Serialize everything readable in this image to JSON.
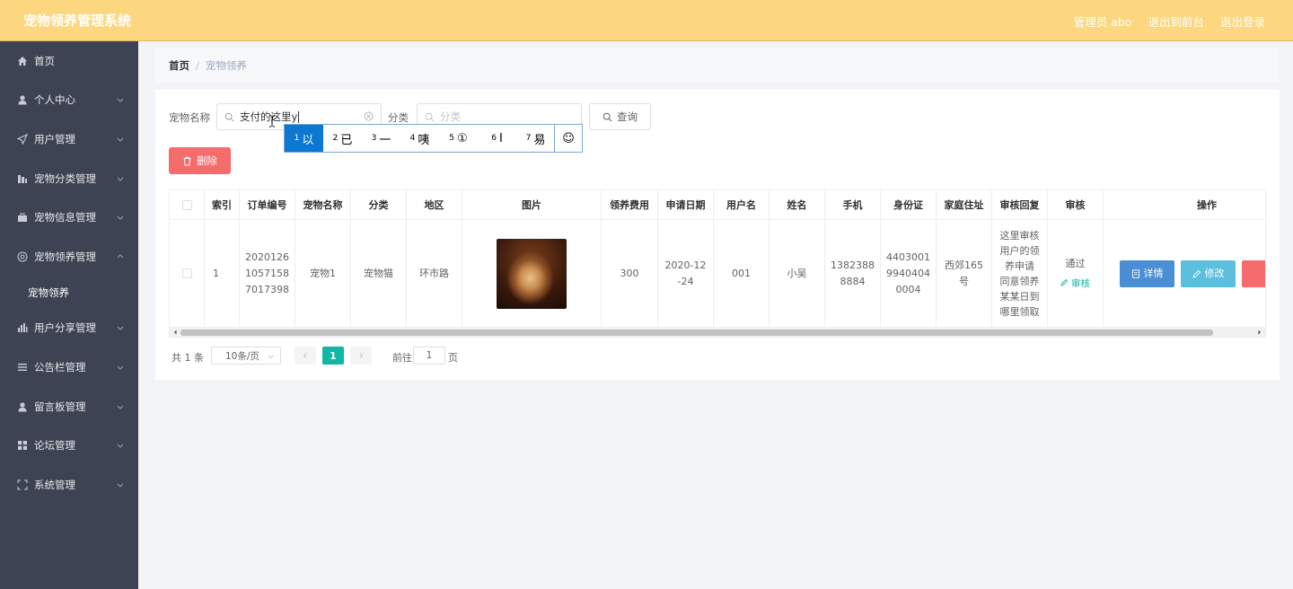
{
  "app": {
    "title": "宠物领养管理系统"
  },
  "topbar": {
    "admin_label": "管理员 abo",
    "front_link": "退出到前台",
    "logout": "退出登录"
  },
  "sidebar": {
    "items": [
      {
        "label": "首页",
        "icon": "home-icon",
        "expandable": false
      },
      {
        "label": "个人中心",
        "icon": "user-icon",
        "expandable": true
      },
      {
        "label": "用户管理",
        "icon": "send-icon",
        "expandable": true
      },
      {
        "label": "宠物分类管理",
        "icon": "chart-icon",
        "expandable": true
      },
      {
        "label": "宠物信息管理",
        "icon": "suitcase-icon",
        "expandable": true
      },
      {
        "label": "宠物领养管理",
        "icon": "globe-icon",
        "expandable": true,
        "open": true
      },
      {
        "label": "用户分享管理",
        "icon": "bar-chart-icon",
        "expandable": true
      },
      {
        "label": "公告栏管理",
        "icon": "list-icon",
        "expandable": true
      },
      {
        "label": "留言板管理",
        "icon": "user-icon",
        "expandable": true
      },
      {
        "label": "论坛管理",
        "icon": "grid-icon",
        "expandable": true
      },
      {
        "label": "系统管理",
        "icon": "fullscreen-icon",
        "expandable": true
      }
    ],
    "submenu": {
      "label": "宠物领养"
    }
  },
  "breadcrumb": {
    "home": "首页",
    "separator": "/",
    "current": "宠物领养"
  },
  "search": {
    "name_label": "宠物名称",
    "name_value": "支付的这里y",
    "category_label": "分类",
    "category_placeholder": "分类",
    "query_button": "查询",
    "delete_button": "删除"
  },
  "ime": {
    "candidates": [
      {
        "num": "1",
        "text": "以"
      },
      {
        "num": "2",
        "text": "已"
      },
      {
        "num": "3",
        "text": "一"
      },
      {
        "num": "4",
        "text": "咦"
      },
      {
        "num": "5",
        "text": "①"
      },
      {
        "num": "6",
        "text": "I"
      },
      {
        "num": "7",
        "text": "易"
      }
    ],
    "emoji": "☺"
  },
  "table": {
    "headers": [
      "索引",
      "订单编号",
      "宠物名称",
      "分类",
      "地区",
      "图片",
      "领养费用",
      "申请日期",
      "用户名",
      "姓名",
      "手机",
      "身份证",
      "家庭住址",
      "审核回复",
      "审核",
      "操作"
    ],
    "row": {
      "index": "1",
      "order_no": "20201261057158 7017398",
      "order_no_lines": [
        "2020126",
        "1057158",
        "7017398"
      ],
      "pet_name": "宠物1",
      "category": "宠物猫",
      "region": "环市路",
      "fee": "300",
      "date_lines": [
        "2020-12",
        "-24"
      ],
      "username": "001",
      "name": "小吴",
      "phone_lines": [
        "1382388",
        "8884"
      ],
      "id_lines": [
        "4403001",
        "9940404",
        "0004"
      ],
      "address_lines": [
        "西郊165",
        "号"
      ],
      "reply_lines": [
        "这里审核",
        "用户的领",
        "养申请",
        "同意领养",
        "某某日到",
        "哪里领取"
      ],
      "audit_status": "通过",
      "audit_link": "审核"
    },
    "actions": {
      "detail": "详情",
      "edit": "修改"
    }
  },
  "pagination": {
    "total": "共 1 条",
    "page_size": "10条/页",
    "current_page": "1",
    "goto_prefix": "前往",
    "goto_value": "1",
    "goto_suffix": "页"
  },
  "colors": {
    "topbar": "#fdd77f",
    "sidebar": "#3e4354",
    "accent": "#13b5a4",
    "danger": "#f56c6c",
    "primary": "#4a8fd4",
    "info": "#5bc0de"
  }
}
